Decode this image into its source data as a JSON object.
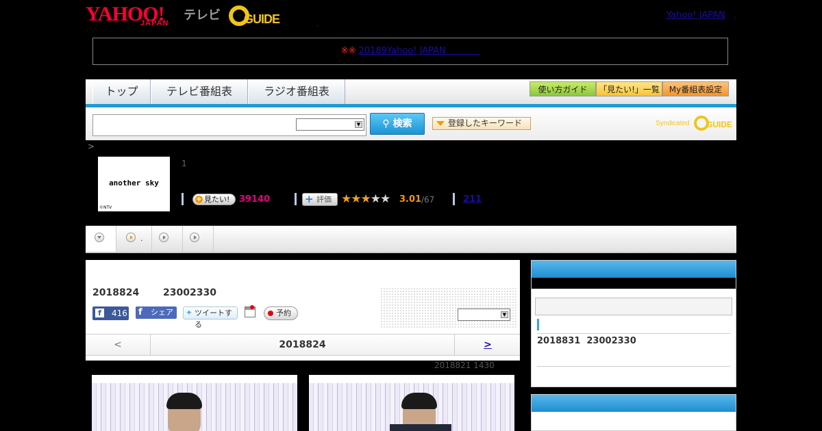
{
  "header": {
    "yahoo_logo": "YAHOO!",
    "japan_logo": "JAPAN",
    "tv_logo": "テレビ",
    "gguide_logo": "GUIDE",
    "yahoo_japan_link": "Yahoo! JAPAN",
    "link_separator": ","
  },
  "notice": {
    "mark": "※※",
    "text": "20189Yahoo! JAPAN"
  },
  "nav": {
    "tabs": [
      "トップ",
      "テレビ番組表",
      "ラジオ番組表"
    ],
    "guide_btn": "使い方ガイド",
    "wish_btn": "「見たい!」一覧",
    "my_btn": "My番組表設定"
  },
  "search": {
    "input_value": "",
    "select_value": "",
    "button_label": "検索",
    "keyword_btn": "登録したキーワード",
    "syndicated": "Syndicated",
    "gguide": "GUIDE"
  },
  "breadcrumb": {
    "sep": ">"
  },
  "program": {
    "thumb_title": "another sky",
    "thumb_credit": "©NTV",
    "episode_num": "1",
    "mitai_label": "見たい!",
    "mitai_count": "39140",
    "hyoka_label": "評価",
    "rating": "3.01",
    "rating_total": "/67",
    "review_count": "211",
    "stars_filled": 3,
    "stars_total": 5
  },
  "tabs": {
    "dot": "."
  },
  "detail": {
    "date": "2018824",
    "time": "23002330",
    "fb_count": "416",
    "fb_share": "シェア",
    "tweet": "ツイートする",
    "reserve": "予約",
    "select_value": "",
    "pager_prev": "<",
    "pager_current": "2018824",
    "pager_next": ">",
    "updated": "2018821  1430"
  },
  "sidebar": {
    "next_date": "2018831",
    "next_time": "23002330"
  },
  "colors": {
    "accent_blue": "#1e9ad6",
    "pink": "#e4007f",
    "orange": "#f39800",
    "yahoo_red": "#ff0033"
  }
}
